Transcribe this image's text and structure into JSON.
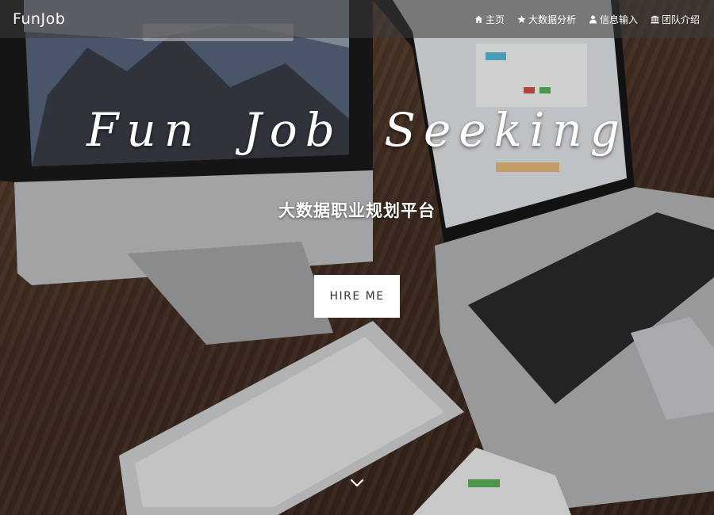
{
  "navbar": {
    "brand": "FunJob",
    "items": [
      {
        "label": "主页",
        "icon": "home-icon"
      },
      {
        "label": "大数据分析",
        "icon": "star-icon"
      },
      {
        "label": "信息输入",
        "icon": "user-icon"
      },
      {
        "label": "团队介绍",
        "icon": "institution-icon"
      }
    ]
  },
  "hero": {
    "title": "Fun Job Seeking",
    "subtitle": "大数据职业规划平台",
    "button_label": "HIRE ME",
    "scroll_icon": "chevron-down-icon"
  },
  "colors": {
    "navbar_bg": "#3c3c3c",
    "button_bg": "#ffffff",
    "button_text": "#333333",
    "text": "#ffffff"
  }
}
